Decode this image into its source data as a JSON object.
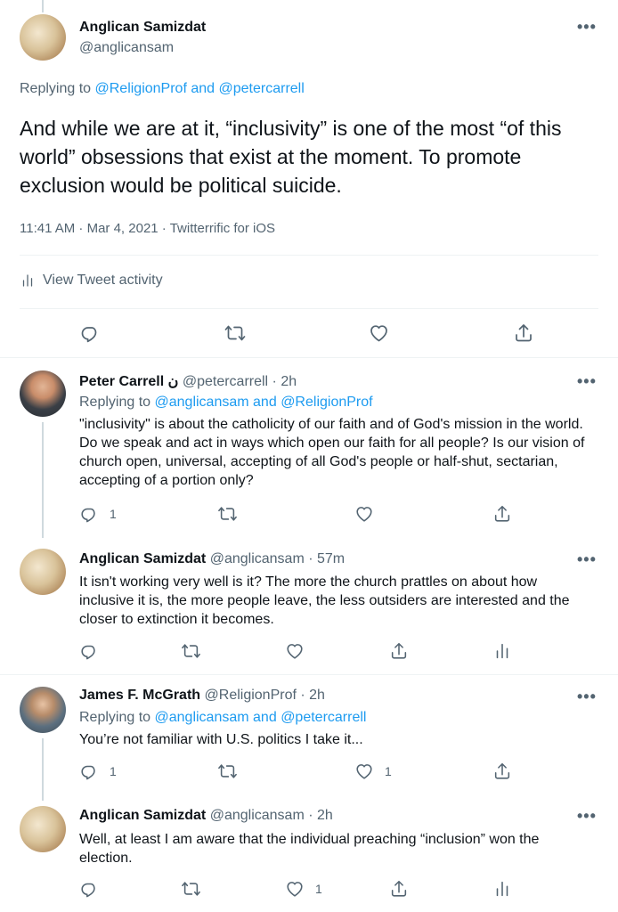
{
  "main_tweet": {
    "display_name": "Anglican Samizdat",
    "handle": "@anglicansam",
    "replying_prefix": "Replying to",
    "replying_to": [
      "@ReligionProf",
      "@petercarrell"
    ],
    "replying_conj": "and",
    "text": "And while we are at it, “inclusivity” is one of the most “of this world” obsessions that exist at the moment. To promote exclusion would be political suicide.",
    "timestamp": "11:41 AM · Mar 4, 2021 · Twitterrific for iOS",
    "activity_label": "View Tweet activity"
  },
  "replies": [
    {
      "display_name": "Peter Carrell",
      "name_glyph": "ن",
      "handle_time": "@petercarrell · 2h",
      "replying_prefix": "Replying to",
      "replying_to": [
        "@anglicansam",
        "@ReligionProf"
      ],
      "replying_conj": "and",
      "text": "\"inclusivity\" is about the catholicity of our faith and of God's mission in the world. Do we speak and act in ways which open our faith for all people? Is our vision of church open, universal, accepting of all God's people or half-shut, sectarian, accepting of a portion only?",
      "reply_count": "1",
      "like_count": ""
    },
    {
      "display_name": "Anglican Samizdat",
      "handle_time": "@anglicansam · 57m",
      "text": "It isn't working very well is it? The more the church prattles on about how inclusive it is, the more people leave, the less outsiders are interested and the closer to extinction it becomes.",
      "reply_count": "",
      "like_count": ""
    },
    {
      "display_name": "James F. McGrath",
      "handle_time": "@ReligionProf · 2h",
      "replying_prefix": "Replying to",
      "replying_to": [
        "@anglicansam",
        "@petercarrell"
      ],
      "replying_conj": "and",
      "text": "You’re not familiar with U.S. politics I take it...",
      "reply_count": "1",
      "like_count": "1"
    },
    {
      "display_name": "Anglican Samizdat",
      "handle_time": "@anglicansam · 2h",
      "text": "Well, at least I am aware that the individual preaching “inclusion” won the election.",
      "reply_count": "",
      "like_count": "1"
    }
  ],
  "icons": {
    "more": "more-dots-icon",
    "reply": "reply-icon",
    "retweet": "retweet-icon",
    "like": "heart-icon",
    "share": "share-icon",
    "analytics": "analytics-icon"
  },
  "colors": {
    "link": "#1d9bf0",
    "muted": "#536471",
    "text": "#0f1419",
    "divider": "#eff3f4",
    "thread_line": "#cfd9de"
  }
}
